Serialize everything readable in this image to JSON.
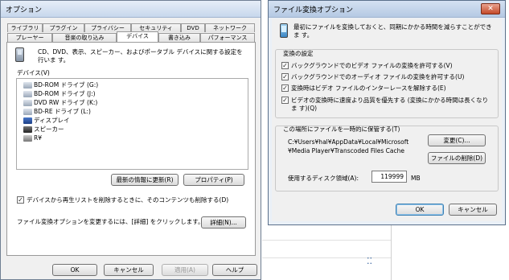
{
  "left_window": {
    "title": "オプション",
    "tabs_row1": [
      "ライブラリ",
      "プラグイン",
      "プライバシー",
      "セキュリティ",
      "DVD",
      "ネットワーク"
    ],
    "tabs_row2": [
      "プレーヤー",
      "音楽の取り込み",
      "デバイス",
      "書き込み",
      "パフォーマンス"
    ],
    "description": "CD、DVD、表示、スピーカー、およびポータブル デバイスに関する設定を行いま す。",
    "devices_label": "デバイス(V)",
    "devices": [
      {
        "name": "BD-ROM ドライブ (G:)",
        "icon": "drive-icon"
      },
      {
        "name": "BD-ROM ドライブ (J:)",
        "icon": "drive-icon"
      },
      {
        "name": "DVD RW ドライブ (K:)",
        "icon": "drive-icon"
      },
      {
        "name": "BD-RE ドライブ (L:)",
        "icon": "drive-icon"
      },
      {
        "name": "ディスプレイ",
        "icon": "display-icon"
      },
      {
        "name": "スピーカー",
        "icon": "speaker-icon"
      },
      {
        "name": "R¥",
        "icon": "portable-device-icon"
      }
    ],
    "refresh_button": "最新の情報に更新(R)",
    "properties_button": "プロパティ(P)",
    "delete_checkbox_label": "デバイスから再生リストを削除するときに、そのコンテンツも削除する(D)",
    "delete_checkbox_checked": true,
    "transcode_text": "ファイル変換オプションを変更するには、[詳細] をクリックします。",
    "advanced_button": "詳細(N)...",
    "ok_button": "OK",
    "cancel_button": "キャンセル",
    "apply_button": "適用(A)",
    "help_button": "ヘルプ"
  },
  "right_window": {
    "title": "ファイル変換オプション",
    "close_label": "✕",
    "description": "最初にファイルを変換しておくと、同期にかかる時間を減らすことができま す。",
    "group1_label": "変換の設定",
    "checkboxes": [
      {
        "label": "バックグラウンドでのビデオ ファイルの変換を許可する(V)",
        "checked": true
      },
      {
        "label": "バックグラウンドでのオーディオ ファイルの変換を許可する(U)",
        "checked": true
      },
      {
        "label": "変換時はビデオ ファイルのインターレースを解除する(E)",
        "checked": true
      },
      {
        "label": "ビデオの変換時に速度より品質を優先する (変換にかかる時間は長くなりま す)(Q)",
        "checked": true
      }
    ],
    "group2_label": "この場所にファイルを一時的に保管する(T)",
    "path_line1": "C:¥Users¥hal¥AppData¥Local¥Microsoft",
    "path_line2": "¥Media Player¥Transcoded Files Cache",
    "change_button": "変更(C)...",
    "delete_files_button": "ファイルの削除(D)",
    "disk_space_label": "使用するディスク領域(A):",
    "disk_space_value": "119999",
    "disk_space_unit": "MB",
    "ok_button": "OK",
    "cancel_button": "キャンセル"
  },
  "background": {
    "glyph": "⁚⁚"
  }
}
